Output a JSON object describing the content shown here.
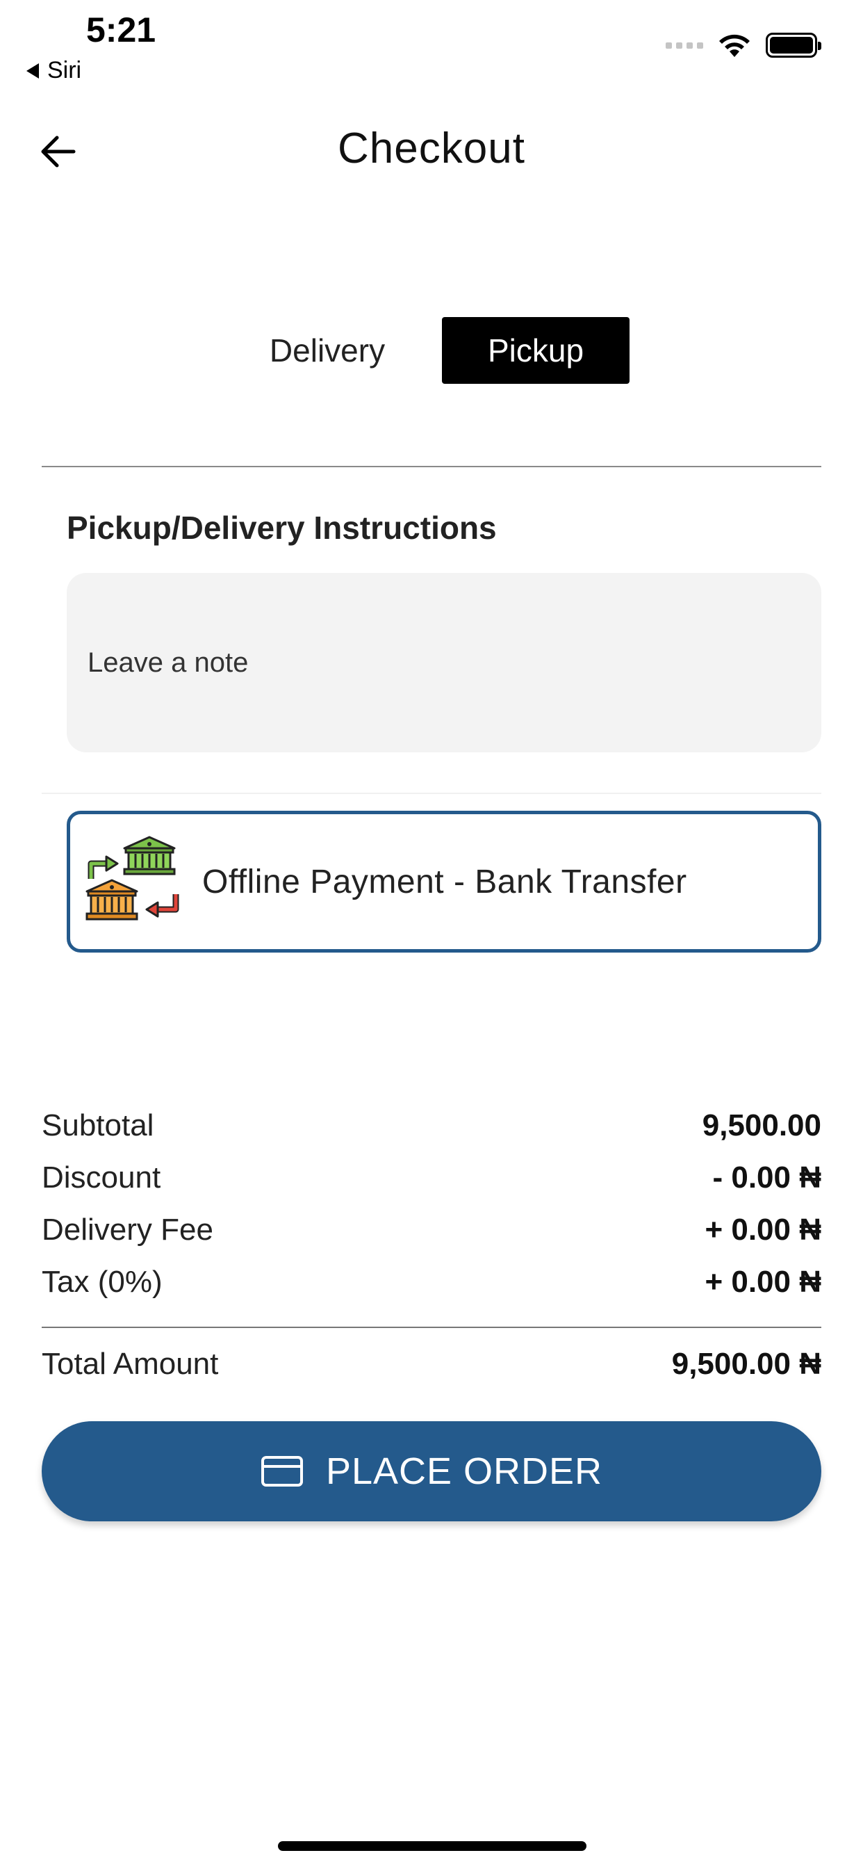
{
  "status_bar": {
    "time": "5:21",
    "back_app": "Siri",
    "icons": [
      "cellular-signal-icon",
      "wifi-icon",
      "battery-icon"
    ]
  },
  "header": {
    "title": "Checkout",
    "back_icon": "arrow-left-icon"
  },
  "tabs": [
    {
      "label": "Delivery",
      "selected": false
    },
    {
      "label": "Pickup",
      "selected": true
    }
  ],
  "instructions": {
    "heading": "Pickup/Delivery Instructions",
    "placeholder": "Leave a note"
  },
  "payment": {
    "label": "Offline Payment - Bank Transfer",
    "icon": "bank-transfer-icon",
    "border_color": "#245a8c"
  },
  "summary": {
    "subtotal": {
      "label": "Subtotal",
      "value": "9,500.00"
    },
    "discount": {
      "label": "Discount",
      "value": "- 0.00 ₦"
    },
    "delivery_fee": {
      "label": "Delivery Fee",
      "value": "+ 0.00 ₦"
    },
    "tax": {
      "label": "Tax (0%)",
      "value": "+ 0.00 ₦"
    },
    "total": {
      "label": "Total Amount",
      "value": "9,500.00 ₦"
    }
  },
  "place_order": {
    "label": "PLACE ORDER",
    "icon": "credit-card-icon",
    "color": "#245a8c"
  }
}
